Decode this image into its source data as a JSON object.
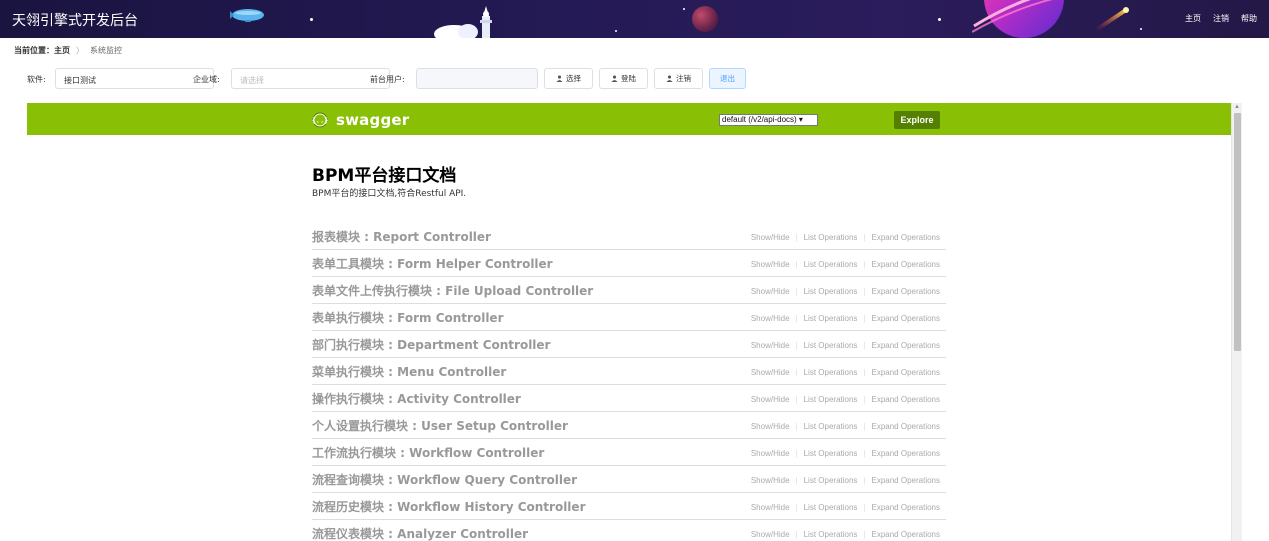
{
  "header": {
    "app_title": "天翎引擎式开发后台",
    "links": [
      "主页",
      "注销",
      "帮助"
    ]
  },
  "breadcrumb": {
    "label": "当前位置：主页",
    "separator": "〉",
    "current": "系统监控"
  },
  "filter": {
    "software_label": "软件:",
    "software_value": "接口测试",
    "domain_label": "企业域:",
    "domain_placeholder": "请选择",
    "frontend_user_label": "前台用户:",
    "frontend_user_value": "",
    "buttons": {
      "select": "选择",
      "login": "登陆",
      "logout": "注销",
      "exit": "退出"
    }
  },
  "swagger": {
    "logo_text": "swagger",
    "api_docs_select": "default (/v2/api-docs) ▾",
    "explore_label": "Explore",
    "doc_title": "BPM平台接口文档",
    "doc_description": "BPM平台的接口文档,符合Restful API.",
    "operations": {
      "show_hide": "Show/Hide",
      "list": "List Operations",
      "expand": "Expand Operations",
      "separator": "|"
    },
    "resources": [
      {
        "name": "报表模块 : Report Controller"
      },
      {
        "name": "表单工具模块 : Form Helper Controller"
      },
      {
        "name": "表单文件上传执行模块 : File Upload Controller"
      },
      {
        "name": "表单执行模块 : Form Controller"
      },
      {
        "name": "部门执行模块 : Department Controller"
      },
      {
        "name": "菜单执行模块 : Menu Controller"
      },
      {
        "name": "操作执行模块 : Activity Controller"
      },
      {
        "name": "个人设置执行模块 : User Setup Controller"
      },
      {
        "name": "工作流执行模块 : Workflow Controller"
      },
      {
        "name": "流程查询模块 : Workflow Query Controller"
      },
      {
        "name": "流程历史模块 : Workflow History Controller"
      },
      {
        "name": "流程仪表模块 : Analyzer Controller"
      }
    ]
  },
  "colors": {
    "header_bg": "#1d1640",
    "swagger_green": "#89bf04",
    "explore_bg": "#547f00",
    "resource_text": "#999999"
  }
}
